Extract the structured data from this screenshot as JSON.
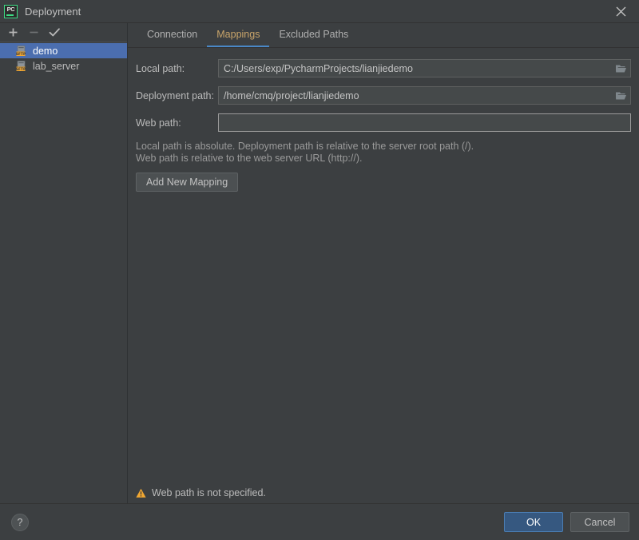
{
  "window": {
    "title": "Deployment",
    "app_icon": "pycharm-logo-icon",
    "app_icon_text": "PC",
    "close_icon": "close-icon"
  },
  "sidebar": {
    "toolbar": [
      {
        "name": "add-server-button",
        "icon": "plus-icon",
        "label": "+"
      },
      {
        "name": "remove-server-button",
        "icon": "minus-icon",
        "label": "−"
      },
      {
        "name": "set-default-server-button",
        "icon": "check-icon",
        "label": "✓"
      }
    ],
    "servers": [
      {
        "label": "demo",
        "icon": "sftp-server-icon",
        "selected": true
      },
      {
        "label": "lab_server",
        "icon": "sftp-server-icon",
        "selected": false
      }
    ]
  },
  "tabs": [
    {
      "label": "Connection",
      "active": false
    },
    {
      "label": "Mappings",
      "active": true
    },
    {
      "label": "Excluded Paths",
      "active": false
    }
  ],
  "form": {
    "local_path": {
      "label": "Local path:",
      "value": "C:/Users/exp/PycharmProjects/lianjiedemo",
      "placeholder": "",
      "browse_icon": "folder-open-icon"
    },
    "deployment_path": {
      "label": "Deployment path:",
      "value": "/home/cmq/project/lianjiedemo",
      "placeholder": "",
      "browse_icon": "folder-open-icon"
    },
    "web_path": {
      "label": "Web path:",
      "value": "",
      "placeholder": ""
    },
    "hint_line1": "Local path is absolute. Deployment path is relative to the server root path (/).",
    "hint_line2": "Web path is relative to the web server URL (http://).",
    "add_mapping_label": "Add New Mapping"
  },
  "status": {
    "warning_icon": "warning-triangle-icon",
    "warning_text": "Web path is not specified."
  },
  "footer": {
    "help_label": "?",
    "help_icon": "question-mark-icon",
    "ok_label": "OK",
    "cancel_label": "Cancel"
  },
  "colors": {
    "dialog_background": "#3c3f41",
    "field_background": "#45494a",
    "selection_blue": "#4b6eaf",
    "tab_active_text": "#c8a46a",
    "tab_underline": "#4a88c7",
    "ok_button": "#365880",
    "warning_amber": "#f0a732",
    "logo_green": "#3ddc84"
  }
}
